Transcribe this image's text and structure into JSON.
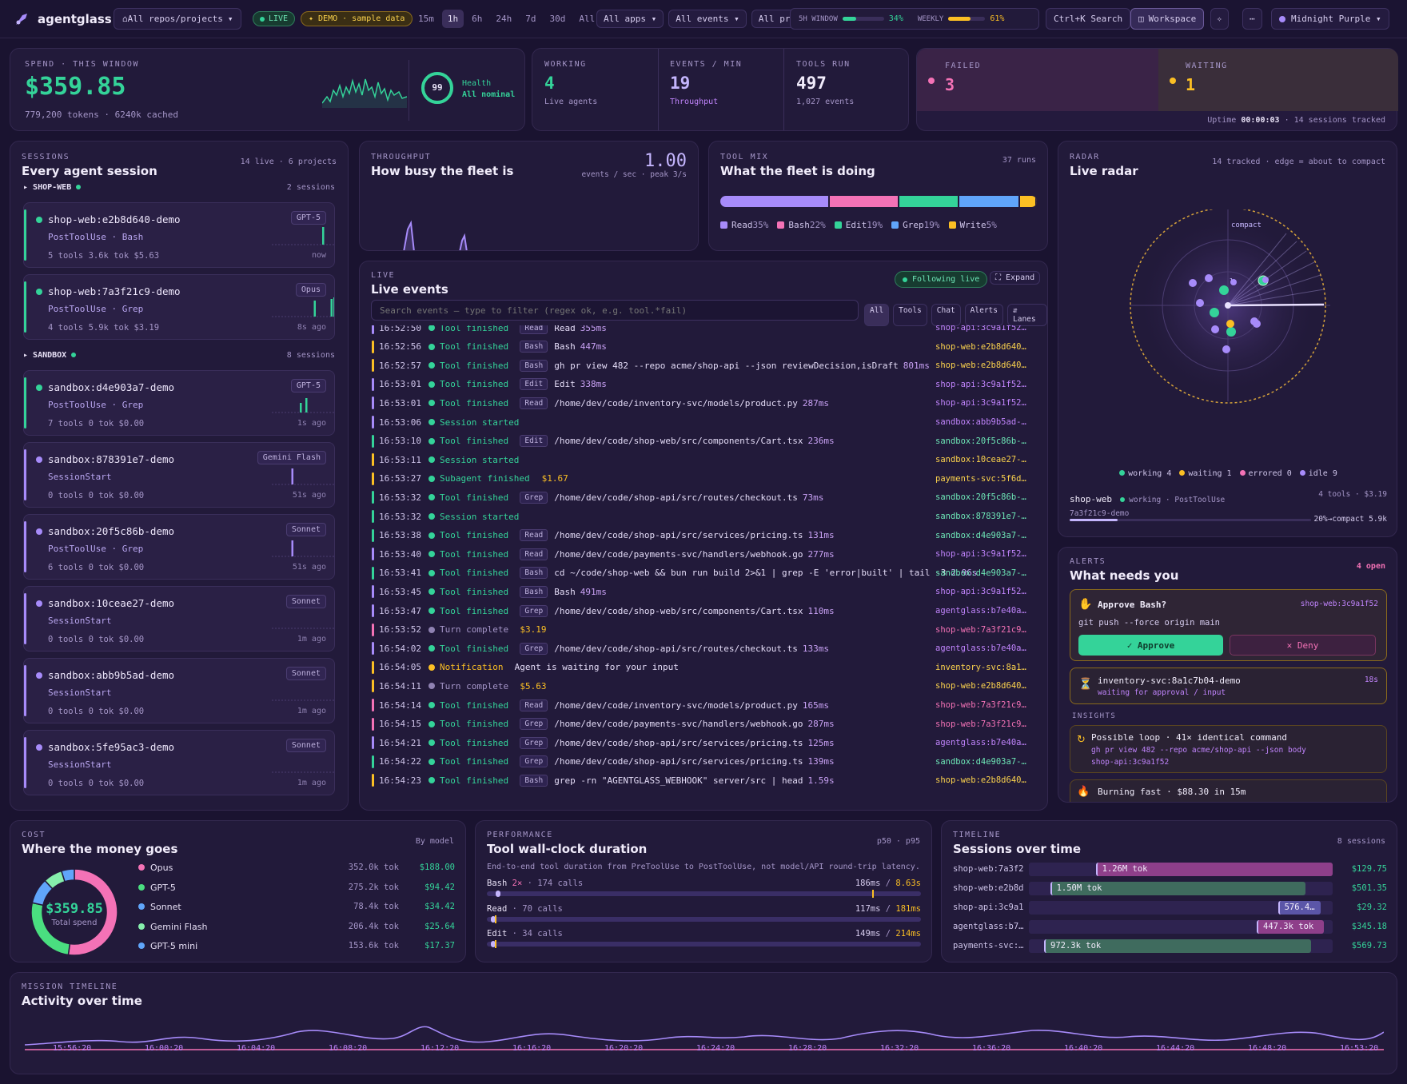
{
  "app": {
    "name": "agentglass",
    "scope": "All repos/projects",
    "live": "LIVE",
    "demo": "✦ DEMO · sample data",
    "ranges": [
      "15m",
      "1h",
      "6h",
      "24h",
      "7d",
      "30d",
      "All"
    ],
    "active_range": "1h",
    "filters": [
      "All apps ▾",
      "All events ▾",
      "All prov"
    ],
    "window5h_label": "5H WINDOW",
    "window5h_pct": "34%",
    "window5h_val": 0.34,
    "weekly_label": "WEEKLY",
    "weekly_pct": "61%",
    "weekly_val": 0.61,
    "search": "Ctrl+K Search",
    "workspace": "Workspace",
    "theme": "Midnight Purple ▾"
  },
  "kpi": {
    "spend_label": "SPEND · THIS WINDOW",
    "spend": "$359.85",
    "spend_sub": "779,200 tokens · 6240k cached",
    "health_score": "99",
    "health_label": "Health",
    "health_status": "All nominal",
    "working_label": "WORKING",
    "working": "4",
    "working_sub": "Live agents",
    "epm_label": "EVENTS / MIN",
    "epm": "19",
    "epm_sub": "Throughput",
    "tools_label": "TOOLS RUN",
    "tools": "497",
    "tools_sub": "1,027 events",
    "failed_label": "FAILED",
    "failed": "3",
    "waiting_label": "WAITING",
    "waiting": "1",
    "uptime_prefix": "Uptime",
    "uptime": "00:00:03",
    "uptime_suffix": "· 14 sessions tracked"
  },
  "sessions": {
    "kicker": "SESSIONS",
    "title": "Every agent session",
    "meta": "14 live · 6 projects",
    "groups": [
      {
        "name": "SHOP-WEB",
        "count": "2 sessions"
      },
      {
        "name": "SANDBOX",
        "count": "8 sessions"
      }
    ],
    "items": [
      {
        "name": "shop-web:e2b8d640-demo",
        "model": "GPT-5",
        "event": "PostToolUse · Bash",
        "stats": "5 tools  3.6k tok  $5.63",
        "ago": "now",
        "color": "#34d399"
      },
      {
        "name": "shop-web:7a3f21c9-demo",
        "model": "Opus",
        "event": "PostToolUse · Grep",
        "stats": "4 tools  5.9k tok  $3.19",
        "ago": "8s ago",
        "color": "#34d399"
      },
      {
        "name": "sandbox:d4e903a7-demo",
        "model": "GPT-5",
        "event": "PostToolUse · Grep",
        "stats": "7 tools  0 tok  $0.00",
        "ago": "1s ago",
        "color": "#34d399"
      },
      {
        "name": "sandbox:878391e7-demo",
        "model": "Gemini Flash",
        "event": "SessionStart",
        "stats": "0 tools  0 tok  $0.00",
        "ago": "51s ago",
        "color": "#a78bfa"
      },
      {
        "name": "sandbox:20f5c86b-demo",
        "model": "Sonnet",
        "event": "PostToolUse · Grep",
        "stats": "6 tools  0 tok  $0.00",
        "ago": "51s ago",
        "color": "#a78bfa"
      },
      {
        "name": "sandbox:10ceae27-demo",
        "model": "Sonnet",
        "event": "SessionStart",
        "stats": "0 tools  0 tok  $0.00",
        "ago": "1m ago",
        "color": "#a78bfa"
      },
      {
        "name": "sandbox:abb9b5ad-demo",
        "model": "Sonnet",
        "event": "SessionStart",
        "stats": "0 tools  0 tok  $0.00",
        "ago": "1m ago",
        "color": "#a78bfa"
      },
      {
        "name": "sandbox:5fe95ac3-demo",
        "model": "Sonnet",
        "event": "SessionStart",
        "stats": "0 tools  0 tok  $0.00",
        "ago": "1m ago",
        "color": "#a78bfa"
      }
    ]
  },
  "throughput": {
    "kicker": "THROUGHPUT",
    "title": "How busy the fleet is",
    "value": "1.00",
    "sub": "events / sec · peak 3/s"
  },
  "toolmix": {
    "kicker": "TOOL MIX",
    "title": "What the fleet is doing",
    "meta": "37 runs",
    "items": [
      {
        "name": "Read",
        "pct": "35%",
        "val": 35,
        "color": "#a78bfa"
      },
      {
        "name": "Bash",
        "pct": "22%",
        "val": 22,
        "color": "#f472b6"
      },
      {
        "name": "Edit",
        "pct": "19%",
        "val": 19,
        "color": "#34d399"
      },
      {
        "name": "Grep",
        "pct": "19%",
        "val": 19,
        "color": "#60a5fa"
      },
      {
        "name": "Write",
        "pct": "5%",
        "val": 5,
        "color": "#fbbf24"
      }
    ]
  },
  "live": {
    "kicker": "LIVE",
    "title": "Live events",
    "following": "Following live",
    "expand": "Expand",
    "search_placeholder": "Search events — type to filter (regex ok, e.g. tool.*fail)",
    "filters": [
      "All",
      "Tools",
      "Chat",
      "Alerts",
      "⇵ Lanes"
    ],
    "events": [
      {
        "t": "16:52:50",
        "k": "Tool finished",
        "tag": "Read",
        "d": "Read",
        "dur": "355ms",
        "s": "shop-api:3c9a1f52…",
        "c": "#a78bfa",
        "kc": "#34d399"
      },
      {
        "t": "16:52:56",
        "k": "Tool finished",
        "tag": "Bash",
        "d": "Bash",
        "dur": "447ms",
        "s": "shop-web:e2b8d640…",
        "c": "#fbbf24",
        "kc": "#34d399"
      },
      {
        "t": "16:52:57",
        "k": "Tool finished",
        "tag": "Bash",
        "d": "gh pr view 482 --repo acme/shop-api --json reviewDecision,isDraft",
        "dur": "801ms",
        "s": "shop-web:e2b8d640…",
        "c": "#fbbf24",
        "kc": "#34d399"
      },
      {
        "t": "16:53:01",
        "k": "Tool finished",
        "tag": "Edit",
        "d": "Edit",
        "dur": "338ms",
        "s": "shop-api:3c9a1f52…",
        "c": "#a78bfa",
        "kc": "#34d399"
      },
      {
        "t": "16:53:01",
        "k": "Tool finished",
        "tag": "Read",
        "d": "/home/dev/code/inventory-svc/models/product.py",
        "dur": "287ms",
        "s": "shop-api:3c9a1f52…",
        "c": "#a78bfa",
        "kc": "#34d399"
      },
      {
        "t": "16:53:06",
        "k": "Session started",
        "tag": "",
        "d": "",
        "dur": "",
        "s": "sandbox:abb9b5ad-…",
        "c": "#a78bfa",
        "kc": "#34d399"
      },
      {
        "t": "16:53:10",
        "k": "Tool finished",
        "tag": "Edit",
        "d": "/home/dev/code/shop-web/src/components/Cart.tsx",
        "dur": "236ms",
        "s": "sandbox:20f5c86b-…",
        "c": "#34d399",
        "kc": "#34d399"
      },
      {
        "t": "16:53:11",
        "k": "Session started",
        "tag": "",
        "d": "",
        "dur": "",
        "s": "sandbox:10ceae27-…",
        "c": "#fbbf24",
        "kc": "#34d399"
      },
      {
        "t": "16:53:27",
        "k": "Subagent finished",
        "tag": "",
        "d": "$1.67",
        "dur": "",
        "s": "payments-svc:5f6d…",
        "c": "#fbbf24",
        "kc": "#34d399"
      },
      {
        "t": "16:53:32",
        "k": "Tool finished",
        "tag": "Grep",
        "d": "/home/dev/code/shop-api/src/routes/checkout.ts",
        "dur": "73ms",
        "s": "sandbox:20f5c86b-…",
        "c": "#34d399",
        "kc": "#34d399"
      },
      {
        "t": "16:53:32",
        "k": "Session started",
        "tag": "",
        "d": "",
        "dur": "",
        "s": "sandbox:878391e7-…",
        "c": "#34d399",
        "kc": "#34d399"
      },
      {
        "t": "16:53:38",
        "k": "Tool finished",
        "tag": "Read",
        "d": "/home/dev/code/shop-api/src/services/pricing.ts",
        "dur": "131ms",
        "s": "sandbox:d4e903a7-…",
        "c": "#34d399",
        "kc": "#34d399"
      },
      {
        "t": "16:53:40",
        "k": "Tool finished",
        "tag": "Read",
        "d": "/home/dev/code/payments-svc/handlers/webhook.go",
        "dur": "277ms",
        "s": "shop-api:3c9a1f52…",
        "c": "#a78bfa",
        "kc": "#34d399"
      },
      {
        "t": "16:53:41",
        "k": "Tool finished",
        "tag": "Bash",
        "d": "cd ~/code/shop-web && bun run build 2>&1 | grep -E 'error|built' | tail -3",
        "dur": "2.96s",
        "s": "sandbox:d4e903a7-…",
        "c": "#34d399",
        "kc": "#34d399"
      },
      {
        "t": "16:53:45",
        "k": "Tool finished",
        "tag": "Bash",
        "d": "Bash",
        "dur": "491ms",
        "s": "shop-api:3c9a1f52…",
        "c": "#a78bfa",
        "kc": "#34d399"
      },
      {
        "t": "16:53:47",
        "k": "Tool finished",
        "tag": "Grep",
        "d": "/home/dev/code/shop-web/src/components/Cart.tsx",
        "dur": "110ms",
        "s": "agentglass:b7e40a…",
        "c": "#a78bfa",
        "kc": "#34d399"
      },
      {
        "t": "16:53:52",
        "k": "Turn complete",
        "tag": "",
        "d": "$3.19",
        "dur": "",
        "s": "shop-web:7a3f21c9…",
        "c": "#f472b6",
        "kc": "#8f82b2"
      },
      {
        "t": "16:54:02",
        "k": "Tool finished",
        "tag": "Grep",
        "d": "/home/dev/code/shop-api/src/routes/checkout.ts",
        "dur": "133ms",
        "s": "agentglass:b7e40a…",
        "c": "#a78bfa",
        "kc": "#34d399"
      },
      {
        "t": "16:54:05",
        "k": "Notification",
        "tag": "",
        "d": "Agent is waiting for your input",
        "dur": "",
        "s": "inventory-svc:8a1…",
        "c": "#fbbf24",
        "kc": "#fbbf24"
      },
      {
        "t": "16:54:11",
        "k": "Turn complete",
        "tag": "",
        "d": "$5.63",
        "dur": "",
        "s": "shop-web:e2b8d640…",
        "c": "#fbbf24",
        "kc": "#8f82b2"
      },
      {
        "t": "16:54:14",
        "k": "Tool finished",
        "tag": "Read",
        "d": "/home/dev/code/inventory-svc/models/product.py",
        "dur": "165ms",
        "s": "shop-web:7a3f21c9…",
        "c": "#f472b6",
        "kc": "#34d399"
      },
      {
        "t": "16:54:15",
        "k": "Tool finished",
        "tag": "Grep",
        "d": "/home/dev/code/payments-svc/handlers/webhook.go",
        "dur": "287ms",
        "s": "shop-web:7a3f21c9…",
        "c": "#f472b6",
        "kc": "#34d399"
      },
      {
        "t": "16:54:21",
        "k": "Tool finished",
        "tag": "Grep",
        "d": "/home/dev/code/shop-api/src/services/pricing.ts",
        "dur": "125ms",
        "s": "agentglass:b7e40a…",
        "c": "#a78bfa",
        "kc": "#34d399"
      },
      {
        "t": "16:54:22",
        "k": "Tool finished",
        "tag": "Grep",
        "d": "/home/dev/code/shop-api/src/services/pricing.ts",
        "dur": "139ms",
        "s": "sandbox:d4e903a7-…",
        "c": "#34d399",
        "kc": "#34d399"
      },
      {
        "t": "16:54:23",
        "k": "Tool finished",
        "tag": "Bash",
        "d": "grep -rn \"AGENTGLASS_WEBHOOK\" server/src | head",
        "dur": "1.59s",
        "s": "shop-web:e2b8d640…",
        "c": "#fbbf24",
        "kc": "#34d399"
      }
    ]
  },
  "radar": {
    "kicker": "RADAR",
    "title": "Live radar",
    "meta": "14 tracked · edge = about to compact",
    "compact": "compact",
    "overlap_label": "l",
    "legend": [
      {
        "name": "working 4",
        "color": "#34d399"
      },
      {
        "name": "waiting 1",
        "color": "#fbbf24"
      },
      {
        "name": "errored 0",
        "color": "#f472b6"
      },
      {
        "name": "idle 9",
        "color": "#a78bfa"
      }
    ],
    "sel_project": "shop-web",
    "sel_state": "working · PostToolUse",
    "sel_stats": "4 tools · $3.19",
    "sel_id": "7a3f21c9-demo",
    "sel_compact": "20%→compact  5.9k",
    "sel_compact_val": 0.2
  },
  "alerts": {
    "kicker": "ALERTS",
    "title": "What needs you",
    "open": "4 open",
    "approve_title": "Approve Bash?",
    "approve_sess": "shop-web:3c9a1f52",
    "approve_cmd": "git push --force origin main",
    "approve_btn": "✓ Approve",
    "deny_btn": "✕ Deny",
    "wait_name": "inventory-svc:8a1c7b04-demo",
    "wait_sub": "waiting for approval / input",
    "wait_age": "18s",
    "insights": "INSIGHTS",
    "loop_title": "Possible loop · 41× identical command",
    "loop_cmd": "gh pr view 482 --repo acme/shop-api --json body",
    "loop_sess": "shop-api:3c9a1f52",
    "burn_title": "Burning fast · $88.30 in 15m"
  },
  "cost": {
    "kicker": "COST",
    "title": "Where the money goes",
    "meta": "By model",
    "total": "$359.85",
    "total_label": "Total spend",
    "models": [
      {
        "name": "Opus",
        "tok": "352.0k tok",
        "cost": "$188.00",
        "val": 188.0,
        "color": "#f472b6"
      },
      {
        "name": "GPT-5",
        "tok": "275.2k tok",
        "cost": "$94.42",
        "val": 94.42,
        "color": "#4ade80"
      },
      {
        "name": "Sonnet",
        "tok": "78.4k tok",
        "cost": "$34.42",
        "val": 34.42,
        "color": "#60a5fa"
      },
      {
        "name": "Gemini Flash",
        "tok": "206.4k tok",
        "cost": "$25.64",
        "val": 25.64,
        "color": "#86efac"
      },
      {
        "name": "GPT-5 mini",
        "tok": "153.6k tok",
        "cost": "$17.37",
        "val": 17.37,
        "color": "#60a5fa"
      }
    ]
  },
  "perf": {
    "kicker": "PERFORMANCE",
    "title": "Tool wall-clock duration",
    "meta": "p50 · p95",
    "desc": "End-to-end tool duration from PreToolUse to PostToolUse, not model/API round-trip latency.",
    "rows": [
      {
        "name": "Bash",
        "mult": "2×",
        "calls": "· 174 calls",
        "p50": "186ms",
        "p95": "8.63s",
        "p50_frac": 0.02,
        "p95_frac": 0.95
      },
      {
        "name": "Read",
        "mult": "",
        "calls": "· 70 calls",
        "p50": "117ms",
        "p95": "181ms",
        "p50_frac": 0.01,
        "p95_frac": 0.02
      },
      {
        "name": "Edit",
        "mult": "",
        "calls": "· 34 calls",
        "p50": "149ms",
        "p95": "214ms",
        "p50_frac": 0.01,
        "p95_frac": 0.02
      }
    ]
  },
  "timeline": {
    "kicker": "TIMELINE",
    "title": "Sessions over time",
    "meta": "8 sessions",
    "rows": [
      {
        "name": "shop-web:7a3f2",
        "tok": "1.26M tok",
        "cost": "$129.75",
        "start": 0.22,
        "end": 1.0,
        "color": "#8e3f8a"
      },
      {
        "name": "shop-web:e2b8d",
        "tok": "1.50M tok",
        "cost": "$501.35",
        "start": 0.07,
        "end": 0.91,
        "color": "#3f6b5e"
      },
      {
        "name": "shop-api:3c9a1",
        "tok": "576.4…",
        "cost": "$29.32",
        "start": 0.82,
        "end": 0.96,
        "color": "#5b56a8"
      },
      {
        "name": "agentglass:b7…",
        "tok": "447.3k tok",
        "cost": "$345.18",
        "start": 0.75,
        "end": 0.97,
        "color": "#8e3f8a"
      },
      {
        "name": "payments-svc:…",
        "tok": "972.3k tok",
        "cost": "$569.73",
        "start": 0.05,
        "end": 0.93,
        "color": "#3f6b5e"
      }
    ]
  },
  "mission": {
    "kicker": "MISSION TIMELINE",
    "title": "Activity over time",
    "ticks": [
      "15:56:20",
      "16:00:20",
      "16:04:20",
      "16:08:20",
      "16:12:20",
      "16:16:20",
      "16:20:20",
      "16:24:20",
      "16:28:20",
      "16:32:20",
      "16:36:20",
      "16:40:20",
      "16:44:20",
      "16:48:20",
      "16:53:20"
    ]
  },
  "colors": {
    "accent": "#a78bfa",
    "green": "#34d399",
    "pink": "#f472b6",
    "amber": "#fbbf24",
    "blue": "#60a5fa"
  }
}
